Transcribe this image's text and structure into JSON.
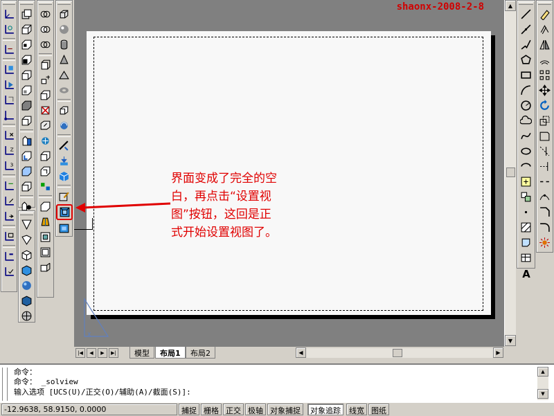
{
  "watermark": "shaonx-2008-2-8",
  "callout": {
    "line1": "界面变成了完全的空",
    "line2": "白，再点击“设置视",
    "line3": "图”按钮，这回是正",
    "line4": "式开始设置视图了。",
    "color": "#e00000"
  },
  "layout_tabs": [
    {
      "label": "模型",
      "active": false
    },
    {
      "label": "布局1",
      "active": true
    },
    {
      "label": "布局2",
      "active": false
    }
  ],
  "command": {
    "line1": "命令：",
    "line2": "命令： _solview",
    "line3": "输入选项 [UCS(U)/正交(O)/辅助(A)/截面(S)]:"
  },
  "status": {
    "coords": "-12.9638, 58.9150, 0.0000",
    "buttons": [
      {
        "label": "捕捉",
        "on": false
      },
      {
        "label": "栅格",
        "on": false
      },
      {
        "label": "正交",
        "on": false
      },
      {
        "label": "极轴",
        "on": false
      },
      {
        "label": "对象捕捉",
        "on": false
      },
      {
        "label": "对象追踪",
        "on": true
      },
      {
        "label": "线宽",
        "on": false
      },
      {
        "label": "图纸",
        "on": false
      }
    ]
  },
  "icons": {
    "ucs_toolbar": [
      "ucs-icon",
      "ucs-origin-icon",
      "ucs-z-icon",
      "ucs-3point-icon",
      "ucs-object-icon",
      "ucs-face-icon",
      "ucs-view-icon",
      "ucs-x-icon",
      "ucs-y-icon",
      "ucs-z-axis-icon",
      "ucs-previous-icon",
      "ucs-world-icon",
      "ucs-move-icon",
      "ucs-manage-icon",
      "ucs-named-icon",
      "ucs-apply-icon"
    ],
    "solids_toolbar": [
      "box-icon",
      "wedge-icon",
      "cone-icon",
      "sphere-icon",
      "cylinder-icon",
      "torus-icon",
      "extrude-icon",
      "revolve-icon",
      "slice-icon",
      "section-icon",
      "interfere-icon",
      "setup-drawing-icon",
      "setup-view-icon",
      "setup-profile-icon"
    ],
    "right_draw_toolbar": [
      "line-icon",
      "construction-line-icon",
      "polyline-icon",
      "polygon-icon",
      "rectangle-icon",
      "arc-icon",
      "circle-icon",
      "revision-cloud-icon",
      "spline-icon",
      "ellipse-icon",
      "ellipse-arc-icon",
      "insert-block-icon",
      "make-block-icon",
      "point-icon",
      "hatch-icon",
      "region-icon",
      "table-icon",
      "multiline-text-icon"
    ]
  }
}
